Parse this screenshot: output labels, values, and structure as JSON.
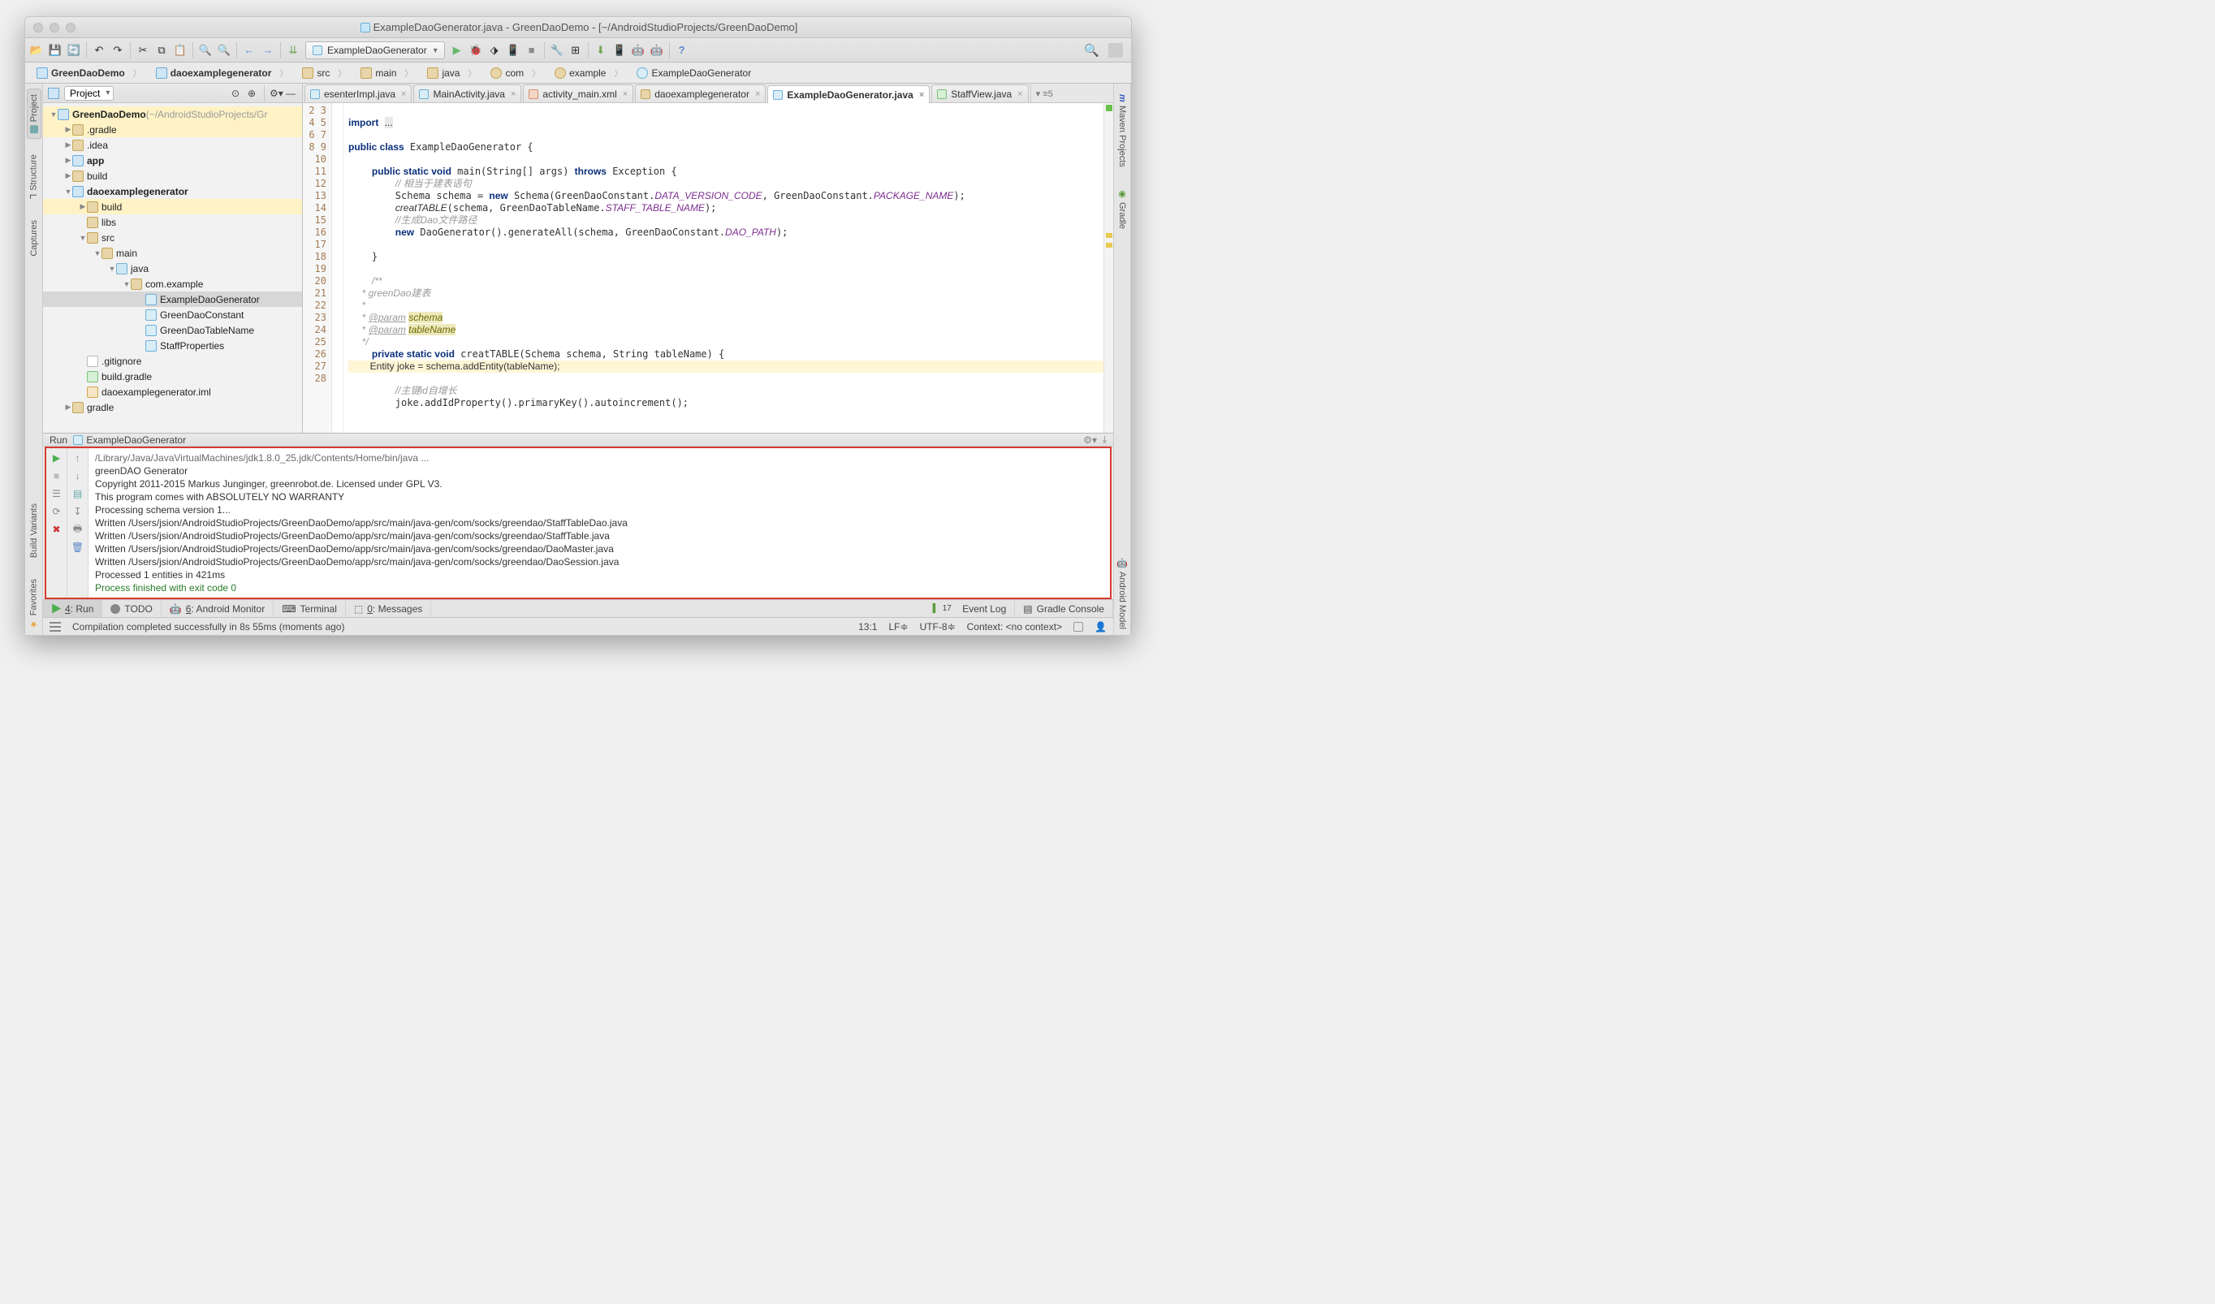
{
  "title": "ExampleDaoGenerator.java - GreenDaoDemo - [~/AndroidStudioProjects/GreenDaoDemo]",
  "runconfig": "ExampleDaoGenerator",
  "breadcrumbs": [
    "GreenDaoDemo",
    "daoexamplegenerator",
    "src",
    "main",
    "java",
    "com",
    "example",
    "ExampleDaoGenerator"
  ],
  "leftTabs": [
    "Project",
    "Structure",
    "Captures",
    "Build Variants",
    "Favorites"
  ],
  "rightTabs": [
    "Maven Projects",
    "Gradle",
    "Android Model"
  ],
  "projectSelector": "Project",
  "tree": [
    {
      "d": 0,
      "a": "▼",
      "ic": "ic-mod",
      "hl": true,
      "bold": true,
      "t": "GreenDaoDemo",
      "suf": " (~/AndroidStudioProjects/Gr"
    },
    {
      "d": 1,
      "a": "▶",
      "ic": "ic-dir",
      "hl": true,
      "t": ".gradle"
    },
    {
      "d": 1,
      "a": "▶",
      "ic": "ic-dir",
      "t": ".idea"
    },
    {
      "d": 1,
      "a": "▶",
      "ic": "ic-mod",
      "bold": true,
      "t": "app"
    },
    {
      "d": 1,
      "a": "▶",
      "ic": "ic-dir",
      "t": "build"
    },
    {
      "d": 1,
      "a": "▼",
      "ic": "ic-mod",
      "bold": true,
      "t": "daoexamplegenerator"
    },
    {
      "d": 2,
      "a": "▶",
      "ic": "ic-dir",
      "hl": true,
      "t": "build"
    },
    {
      "d": 2,
      "a": "",
      "ic": "ic-dir",
      "t": "libs"
    },
    {
      "d": 2,
      "a": "▼",
      "ic": "ic-dir",
      "t": "src"
    },
    {
      "d": 3,
      "a": "▼",
      "ic": "ic-dir",
      "t": "main"
    },
    {
      "d": 4,
      "a": "▼",
      "ic": "ic-dirsrc",
      "t": "java"
    },
    {
      "d": 5,
      "a": "▼",
      "ic": "ic-pkg",
      "t": "com.example"
    },
    {
      "d": 6,
      "a": "",
      "ic": "ic-cls",
      "sel": true,
      "t": "ExampleDaoGenerator"
    },
    {
      "d": 6,
      "a": "",
      "ic": "ic-cls",
      "t": "GreenDaoConstant"
    },
    {
      "d": 6,
      "a": "",
      "ic": "ic-cls",
      "t": "GreenDaoTableName"
    },
    {
      "d": 6,
      "a": "",
      "ic": "ic-cls",
      "t": "StaffProperties"
    },
    {
      "d": 2,
      "a": "",
      "ic": "ic-file",
      "t": ".gitignore"
    },
    {
      "d": 2,
      "a": "",
      "ic": "ic-gradle",
      "t": "build.gradle"
    },
    {
      "d": 2,
      "a": "",
      "ic": "ic-iml",
      "t": "daoexamplegenerator.iml"
    },
    {
      "d": 1,
      "a": "▶",
      "ic": "ic-dir",
      "t": "gradle"
    }
  ],
  "tabs": [
    {
      "t": "esenterImpl.java",
      "ic": "ti-j"
    },
    {
      "t": "MainActivity.java",
      "ic": "ti-j"
    },
    {
      "t": "activity_main.xml",
      "ic": "ti-x"
    },
    {
      "t": "daoexamplegenerator",
      "ic": "ti-p"
    },
    {
      "t": "ExampleDaoGenerator.java",
      "ic": "ti-j",
      "active": true
    },
    {
      "t": "StaffView.java",
      "ic": "ti-i"
    }
  ],
  "tabs_more": "▾ ≡5",
  "lines_start": 2,
  "lines_end": 28,
  "run": {
    "title_prefix": "Run",
    "title": "ExampleDaoGenerator",
    "lines": [
      {
        "cls": "path",
        "t": "/Library/Java/JavaVirtualMachines/jdk1.8.0_25.jdk/Contents/Home/bin/java ..."
      },
      {
        "t": "greenDAO Generator"
      },
      {
        "t": "Copyright 2011-2015 Markus Junginger, greenrobot.de. Licensed under GPL V3."
      },
      {
        "t": "This program comes with ABSOLUTELY NO WARRANTY"
      },
      {
        "t": "Processing schema version 1..."
      },
      {
        "t": "Written /Users/jsion/AndroidStudioProjects/GreenDaoDemo/app/src/main/java-gen/com/socks/greendao/StaffTableDao.java"
      },
      {
        "t": "Written /Users/jsion/AndroidStudioProjects/GreenDaoDemo/app/src/main/java-gen/com/socks/greendao/StaffTable.java"
      },
      {
        "t": "Written /Users/jsion/AndroidStudioProjects/GreenDaoDemo/app/src/main/java-gen/com/socks/greendao/DaoMaster.java"
      },
      {
        "t": "Written /Users/jsion/AndroidStudioProjects/GreenDaoDemo/app/src/main/java-gen/com/socks/greendao/DaoSession.java"
      },
      {
        "t": "Processed 1 entities in 421ms"
      },
      {
        "t": ""
      },
      {
        "cls": "exit",
        "t": "Process finished with exit code 0"
      }
    ]
  },
  "bottomTabs": {
    "run": "4: Run",
    "todo": "TODO",
    "monitor": "6: Android Monitor",
    "terminal": "Terminal",
    "messages": "0: Messages",
    "eventlog": "Event Log",
    "eventcount": "17",
    "gradle": "Gradle Console"
  },
  "status": {
    "msg": "Compilation completed successfully in 8s 55ms (moments ago)",
    "pos": "13:1",
    "lf": "LF",
    "enc": "UTF-8",
    "ctx": "Context: <no context>"
  }
}
